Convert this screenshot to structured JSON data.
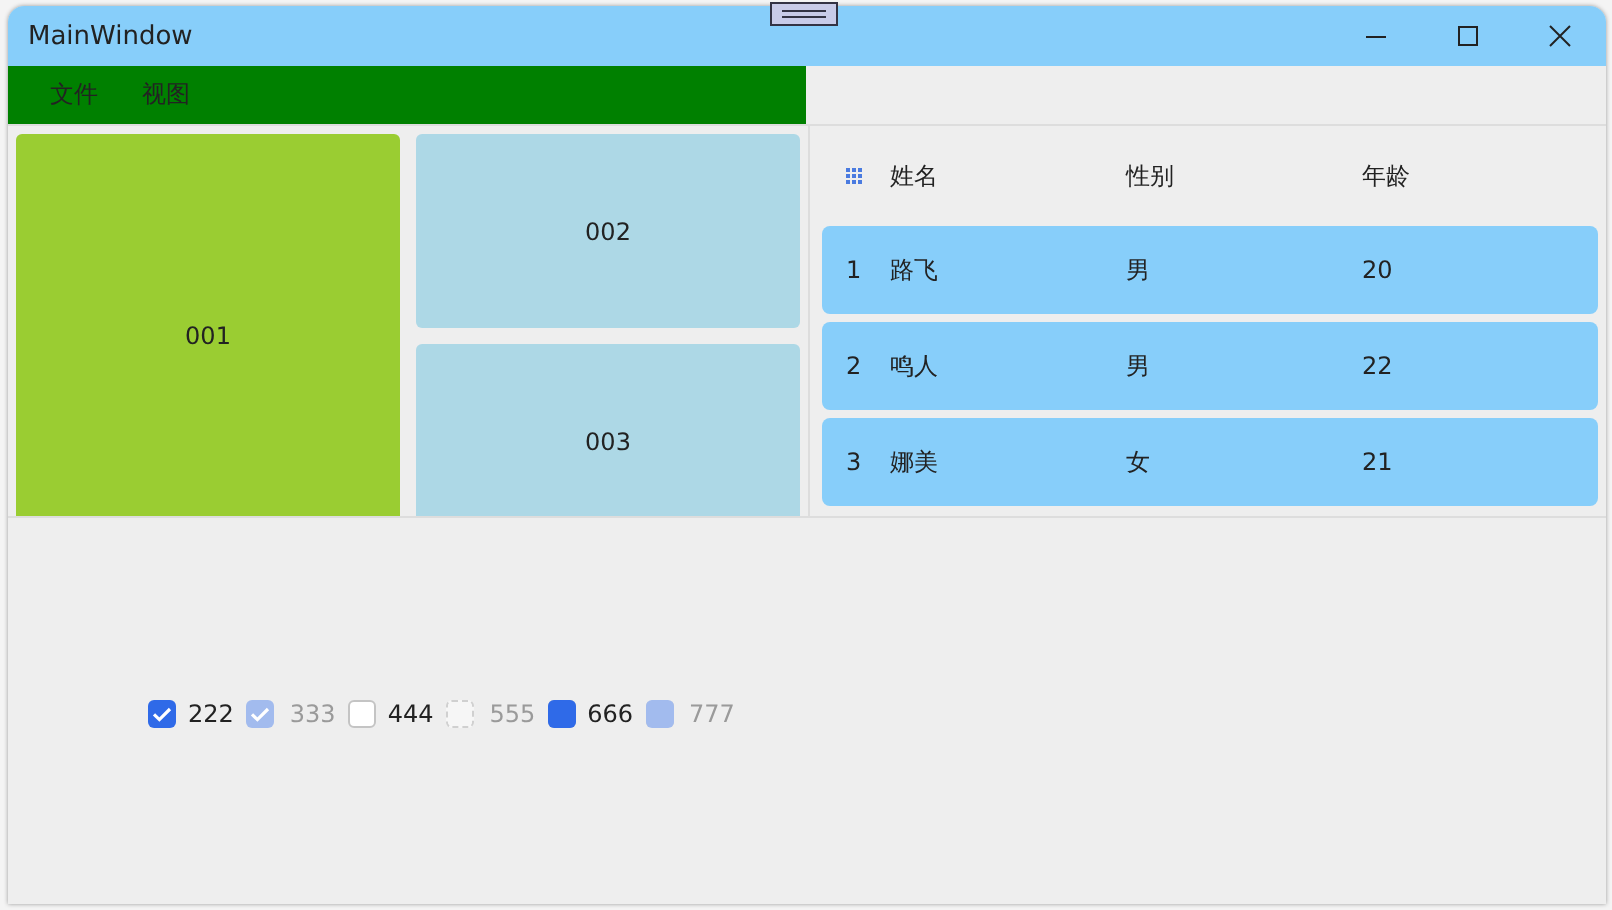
{
  "window": {
    "title": "MainWindow"
  },
  "menu": [
    "文件",
    "视图"
  ],
  "tiles": [
    {
      "label": "001",
      "color": "#9acd32"
    },
    {
      "label": "002",
      "color": "#add8e6"
    },
    {
      "label": "003",
      "color": "#add8e6"
    }
  ],
  "table": {
    "columns": [
      "姓名",
      "性别",
      "年龄"
    ],
    "rows": [
      {
        "index": "1",
        "cells": [
          "路飞",
          "男",
          "20"
        ]
      },
      {
        "index": "2",
        "cells": [
          "鸣人",
          "男",
          "22"
        ]
      },
      {
        "index": "3",
        "cells": [
          "娜美",
          "女",
          "21"
        ]
      }
    ]
  },
  "checkboxes": [
    {
      "label": "222",
      "checked": true,
      "partial": false,
      "disabled": false
    },
    {
      "label": "333",
      "checked": true,
      "partial": false,
      "disabled": true
    },
    {
      "label": "444",
      "checked": false,
      "partial": false,
      "disabled": false
    },
    {
      "label": "555",
      "checked": false,
      "partial": false,
      "disabled": true
    },
    {
      "label": "666",
      "checked": false,
      "partial": true,
      "disabled": false
    },
    {
      "label": "777",
      "checked": false,
      "partial": true,
      "disabled": true
    }
  ]
}
